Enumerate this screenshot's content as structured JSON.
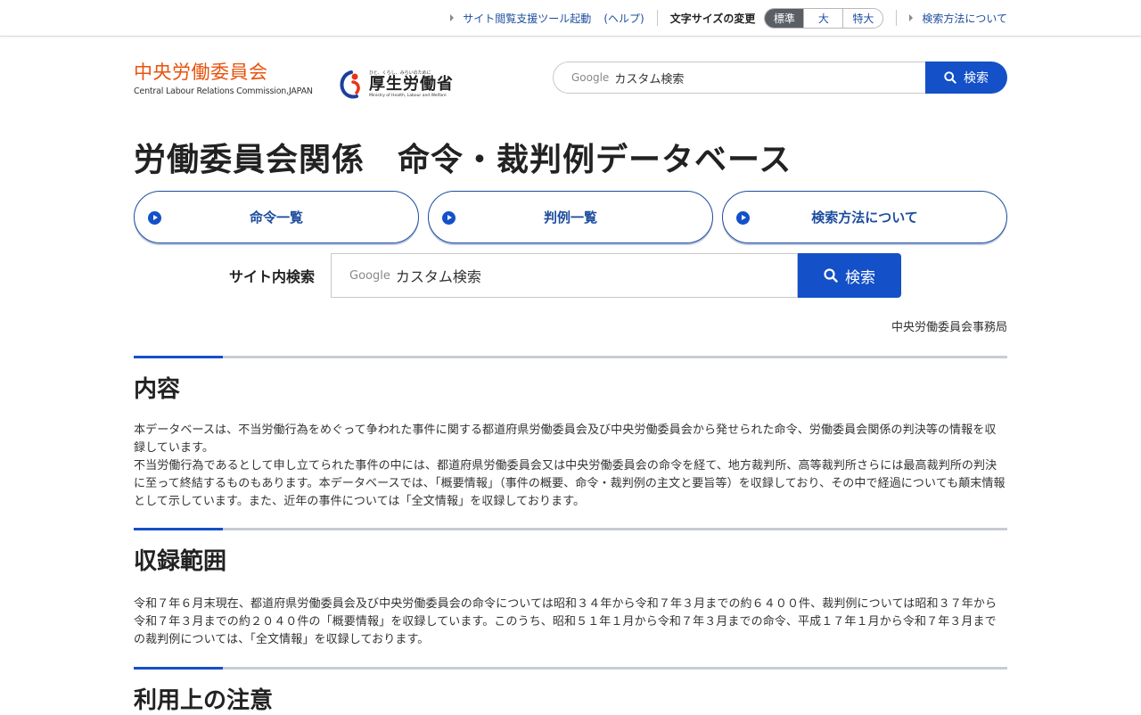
{
  "topbar": {
    "support_tool": "サイト閲覧支援ツール起動",
    "help": "(ヘルプ)",
    "font_size_label": "文字サイズの変更",
    "font_sizes": [
      "標準",
      "大",
      "特大"
    ],
    "search_help": "検索方法について"
  },
  "header": {
    "logo_jp": "中央労働委員会",
    "logo_en": "Central Labour Relations Commission,JAPAN",
    "mhlw_sub": "ひと、くらし、みらいのために",
    "mhlw_jp": "厚生労働省",
    "mhlw_en": "Ministry of Health, Labour and Welfare",
    "search_brand": "Google",
    "search_placeholder": "カスタム検索",
    "search_button": "検索"
  },
  "page_title": "労働委員会関係　命令・裁判例データベース",
  "nav": [
    {
      "label": "命令一覧"
    },
    {
      "label": "判例一覧"
    },
    {
      "label": "検索方法について"
    }
  ],
  "site_search": {
    "label": "サイト内検索",
    "brand": "Google",
    "placeholder": "カスタム検索",
    "button": "検索"
  },
  "org": "中央労働委員会事務局",
  "sections": [
    {
      "heading": "内容",
      "paragraphs": [
        "本データベースは、不当労働行為をめぐって争われた事件に関する都道府県労働委員会及び中央労働委員会から発せられた命令、労働委員会関係の判決等の情報を収録しています。",
        "不当労働行為であるとして申し立てられた事件の中には、都道府県労働委員会又は中央労働委員会の命令を経て、地方裁判所、高等裁判所さらには最高裁判所の判決に至って終結するものもあります。本データベースでは、「概要情報」（事件の概要、命令・裁判例の主文と要旨等）を収録しており、その中で経過についても顛末情報として示しています。また、近年の事件については「全文情報」を収録しております。"
      ]
    },
    {
      "heading": "収録範囲",
      "paragraphs": [
        "令和７年６月末現在、都道府県労働委員会及び中央労働委員会の命令については昭和３４年から令和７年３月までの約６４００件、裁判例については昭和３７年から令和７年３月までの約２０４０件の「概要情報」を収録しています。このうち、昭和５１年１月から令和７年３月までの命令、平成１７年１月から令和７年３月までの裁判例については、「全文情報」を収録しております。"
      ]
    },
    {
      "heading": "利用上の注意",
      "paragraphs": []
    }
  ],
  "colors": {
    "accent": "#1450c8",
    "link": "#1d4d9e",
    "logo_orange": "#e8530e"
  }
}
